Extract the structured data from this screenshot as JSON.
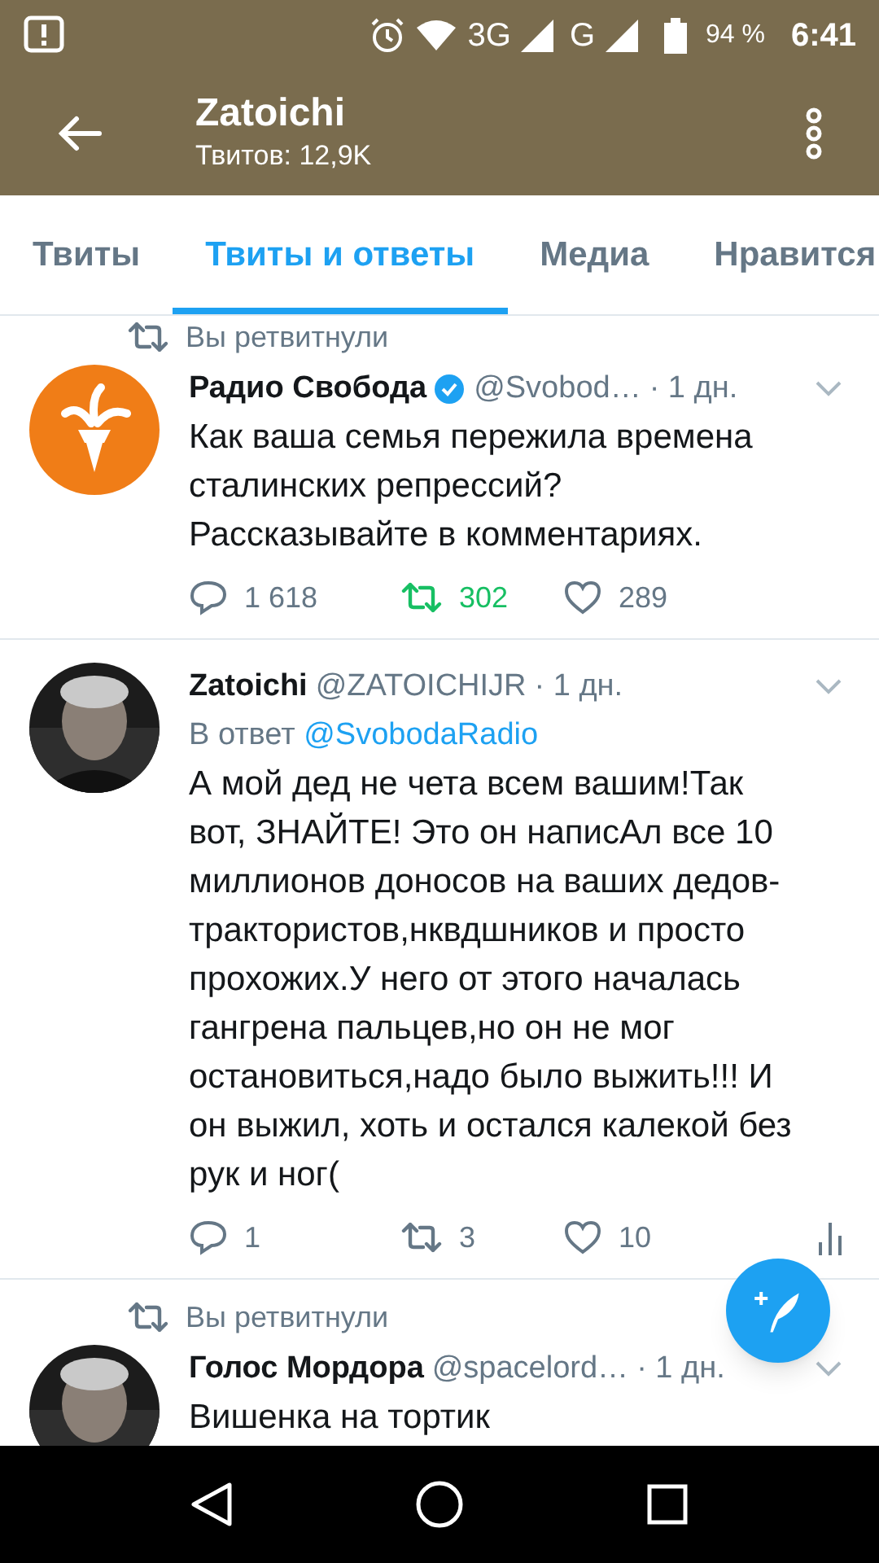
{
  "status_bar": {
    "network_3g": "3G",
    "network_g": "G",
    "battery": "94 %",
    "time": "6:41"
  },
  "header": {
    "title": "Zatoichi",
    "subtitle": "Твитов: 12,9K"
  },
  "tabs": [
    {
      "label": "Твиты",
      "selected": false
    },
    {
      "label": "Твиты и ответы",
      "selected": true
    },
    {
      "label": "Медиа",
      "selected": false
    },
    {
      "label": "Нравится",
      "selected": false
    }
  ],
  "tweets": [
    {
      "retweeted_by": "Вы ретвитнули",
      "avatar": {
        "kind": "logo"
      },
      "name": "Радио Свобода",
      "verified": true,
      "handle": "@Svobod…",
      "time": "· 1 дн.",
      "text": "Как ваша семья пережила времена сталинских репрессий? Рассказывайте в комментариях.",
      "replies": "1 618",
      "retweets": "302",
      "retweeted": true,
      "likes": "289",
      "analytics": false
    },
    {
      "name": "Zatoichi",
      "verified": false,
      "handle": "@ZATOICHIJR",
      "time": "· 1 дн.",
      "reply_label": "В ответ",
      "reply_to": "@SvobodaRadio",
      "text": "А мой дед не чета всем вашим!Так вот, ЗНАЙТЕ! Это он написАл все 10 миллионов доносов на ваших дедов-трактористов,нквдшников и просто прохожих.У него от этого началась гангрена пальцев,но он не мог остановиться,надо было выжить!!! И он выжил, хоть и остался калекой без рук и ног(",
      "replies": "1",
      "retweets": "3",
      "retweeted": false,
      "likes": "10",
      "analytics": true
    },
    {
      "retweeted_by": "Вы ретвитнули",
      "name": "Голос Мордора",
      "verified": false,
      "handle": "@spacelord…",
      "time": "· 1 дн.",
      "text": "Вишенка на тортик"
    }
  ]
}
